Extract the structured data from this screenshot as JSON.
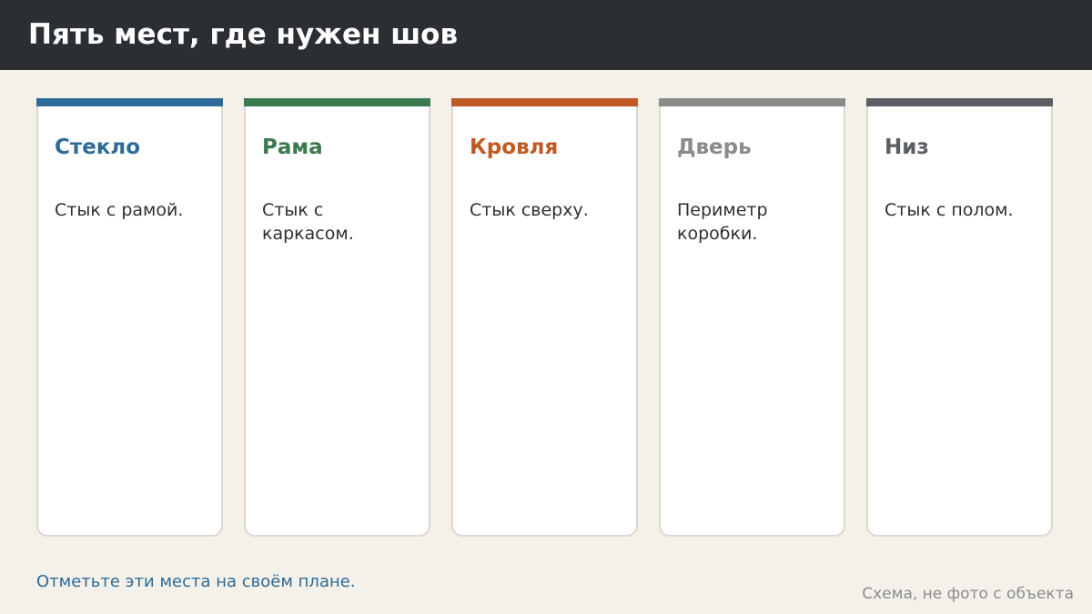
{
  "header": {
    "title": "Пять мест, где нужен шов"
  },
  "cards": [
    {
      "title": "Стекло",
      "text": "Стык с рамой.",
      "accent_color": "#2f6b98"
    },
    {
      "title": "Рама",
      "text": "Стык с каркасом.",
      "accent_color": "#3b7a4e"
    },
    {
      "title": "Кровля",
      "text": "Стык сверху.",
      "accent_color": "#c05a24"
    },
    {
      "title": "Дверь",
      "text": "Периметр коробки.",
      "accent_color": "#8a8a88"
    },
    {
      "title": "Низ",
      "text": "Стык с полом.",
      "accent_color": "#5b5e64"
    }
  ],
  "footer": {
    "note": "Отметьте эти места на своём плане.",
    "caption": "Схема, не фото с объекта"
  }
}
